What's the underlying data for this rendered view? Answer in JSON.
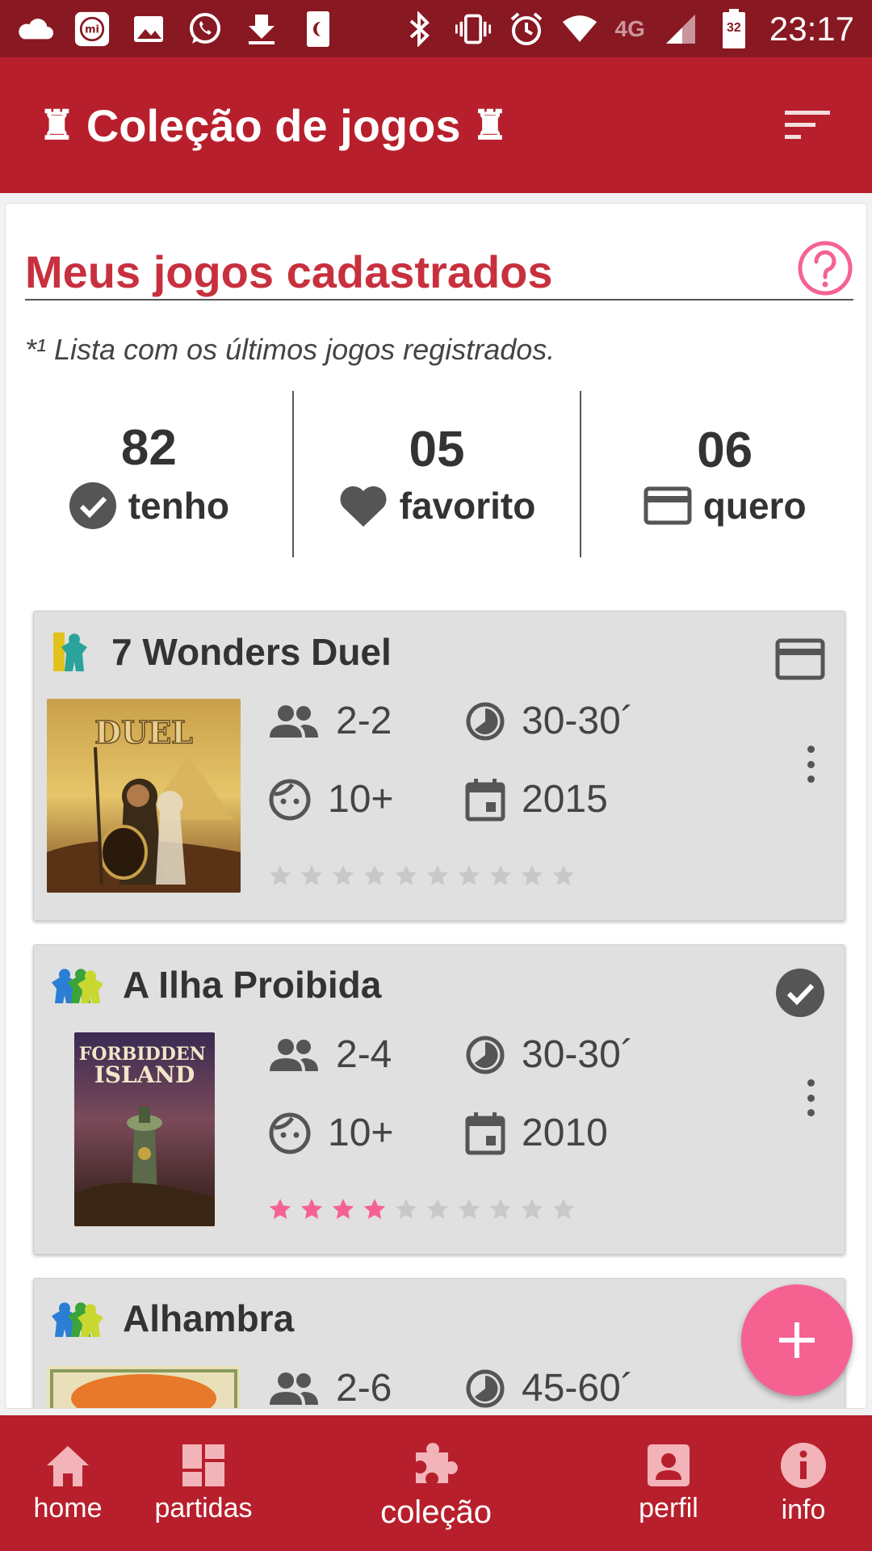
{
  "status_bar": {
    "network": "4G",
    "battery": "32",
    "time": "23:17"
  },
  "app_bar": {
    "title": "Coleção de jogos",
    "sort_icon": "sort-icon"
  },
  "section": {
    "title": "Meus jogos cadastrados",
    "note": "*¹ Lista com os últimos jogos registrados."
  },
  "stats": [
    {
      "count": "82",
      "label": "tenho",
      "icon": "check-circle-icon"
    },
    {
      "count": "05",
      "label": "favorito",
      "icon": "heart-icon"
    },
    {
      "count": "06",
      "label": "quero",
      "icon": "card-icon"
    }
  ],
  "games": [
    {
      "title": "7 Wonders Duel",
      "players": "2-2",
      "time": "30-30´",
      "age": "10+",
      "year": "2015",
      "rating": 0,
      "max_rating": 10,
      "status_icon": "card-icon",
      "cover_title": "DUEL"
    },
    {
      "title": "A Ilha Proibida",
      "players": "2-4",
      "time": "30-30´",
      "age": "10+",
      "year": "2010",
      "rating": 4,
      "max_rating": 10,
      "status_icon": "check-circle-icon",
      "cover_title": "FORBIDDEN ISLAND"
    },
    {
      "title": "Alhambra",
      "players": "2-6",
      "time": "45-60´"
    }
  ],
  "bottom_nav": [
    {
      "label": "home",
      "icon": "home-icon"
    },
    {
      "label": "partidas",
      "icon": "dashboard-icon"
    },
    {
      "label": "coleção",
      "icon": "puzzle-icon"
    },
    {
      "label": "perfil",
      "icon": "profile-icon"
    },
    {
      "label": "info",
      "icon": "info-icon"
    }
  ],
  "colors": {
    "status_bar": "#881822",
    "primary": "#b81f2c",
    "title_red": "#c8303e",
    "accent_pink": "#f56292",
    "star_empty": "#c8c8c8"
  }
}
